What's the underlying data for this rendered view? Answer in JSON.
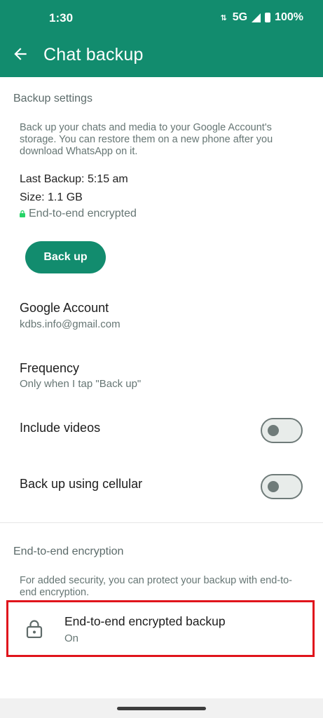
{
  "status_bar": {
    "time": "1:30",
    "network": "5G",
    "battery": "100%"
  },
  "appbar": {
    "title": "Chat backup",
    "back_icon": "arrow-left-icon"
  },
  "backup_settings": {
    "section_title": "Backup settings",
    "description": "Back up your chats and media to your Google Account's storage. You can restore them on a new phone after you download WhatsApp on it.",
    "last_backup": "Last Backup: 5:15 am",
    "size": "Size: 1.1 GB",
    "encrypted_label": "End-to-end encrypted",
    "backup_button": "Back up",
    "google_account_title": "Google Account",
    "google_account_value": "kdbs.info@gmail.com",
    "frequency_title": "Frequency",
    "frequency_value": "Only when I tap \"Back up\"",
    "include_videos_label": "Include videos",
    "include_videos_on": false,
    "cellular_label": "Back up using cellular",
    "cellular_on": false
  },
  "encryption": {
    "section_title": "End-to-end encryption",
    "description": "For added security, you can protect your backup with end-to-end encryption.",
    "row_title": "End-to-end encrypted backup",
    "row_status": "On",
    "icon": "lock-icon"
  },
  "colors": {
    "brand": "#128c6e",
    "highlight": "#e0141c",
    "lock_green": "#25d366"
  }
}
